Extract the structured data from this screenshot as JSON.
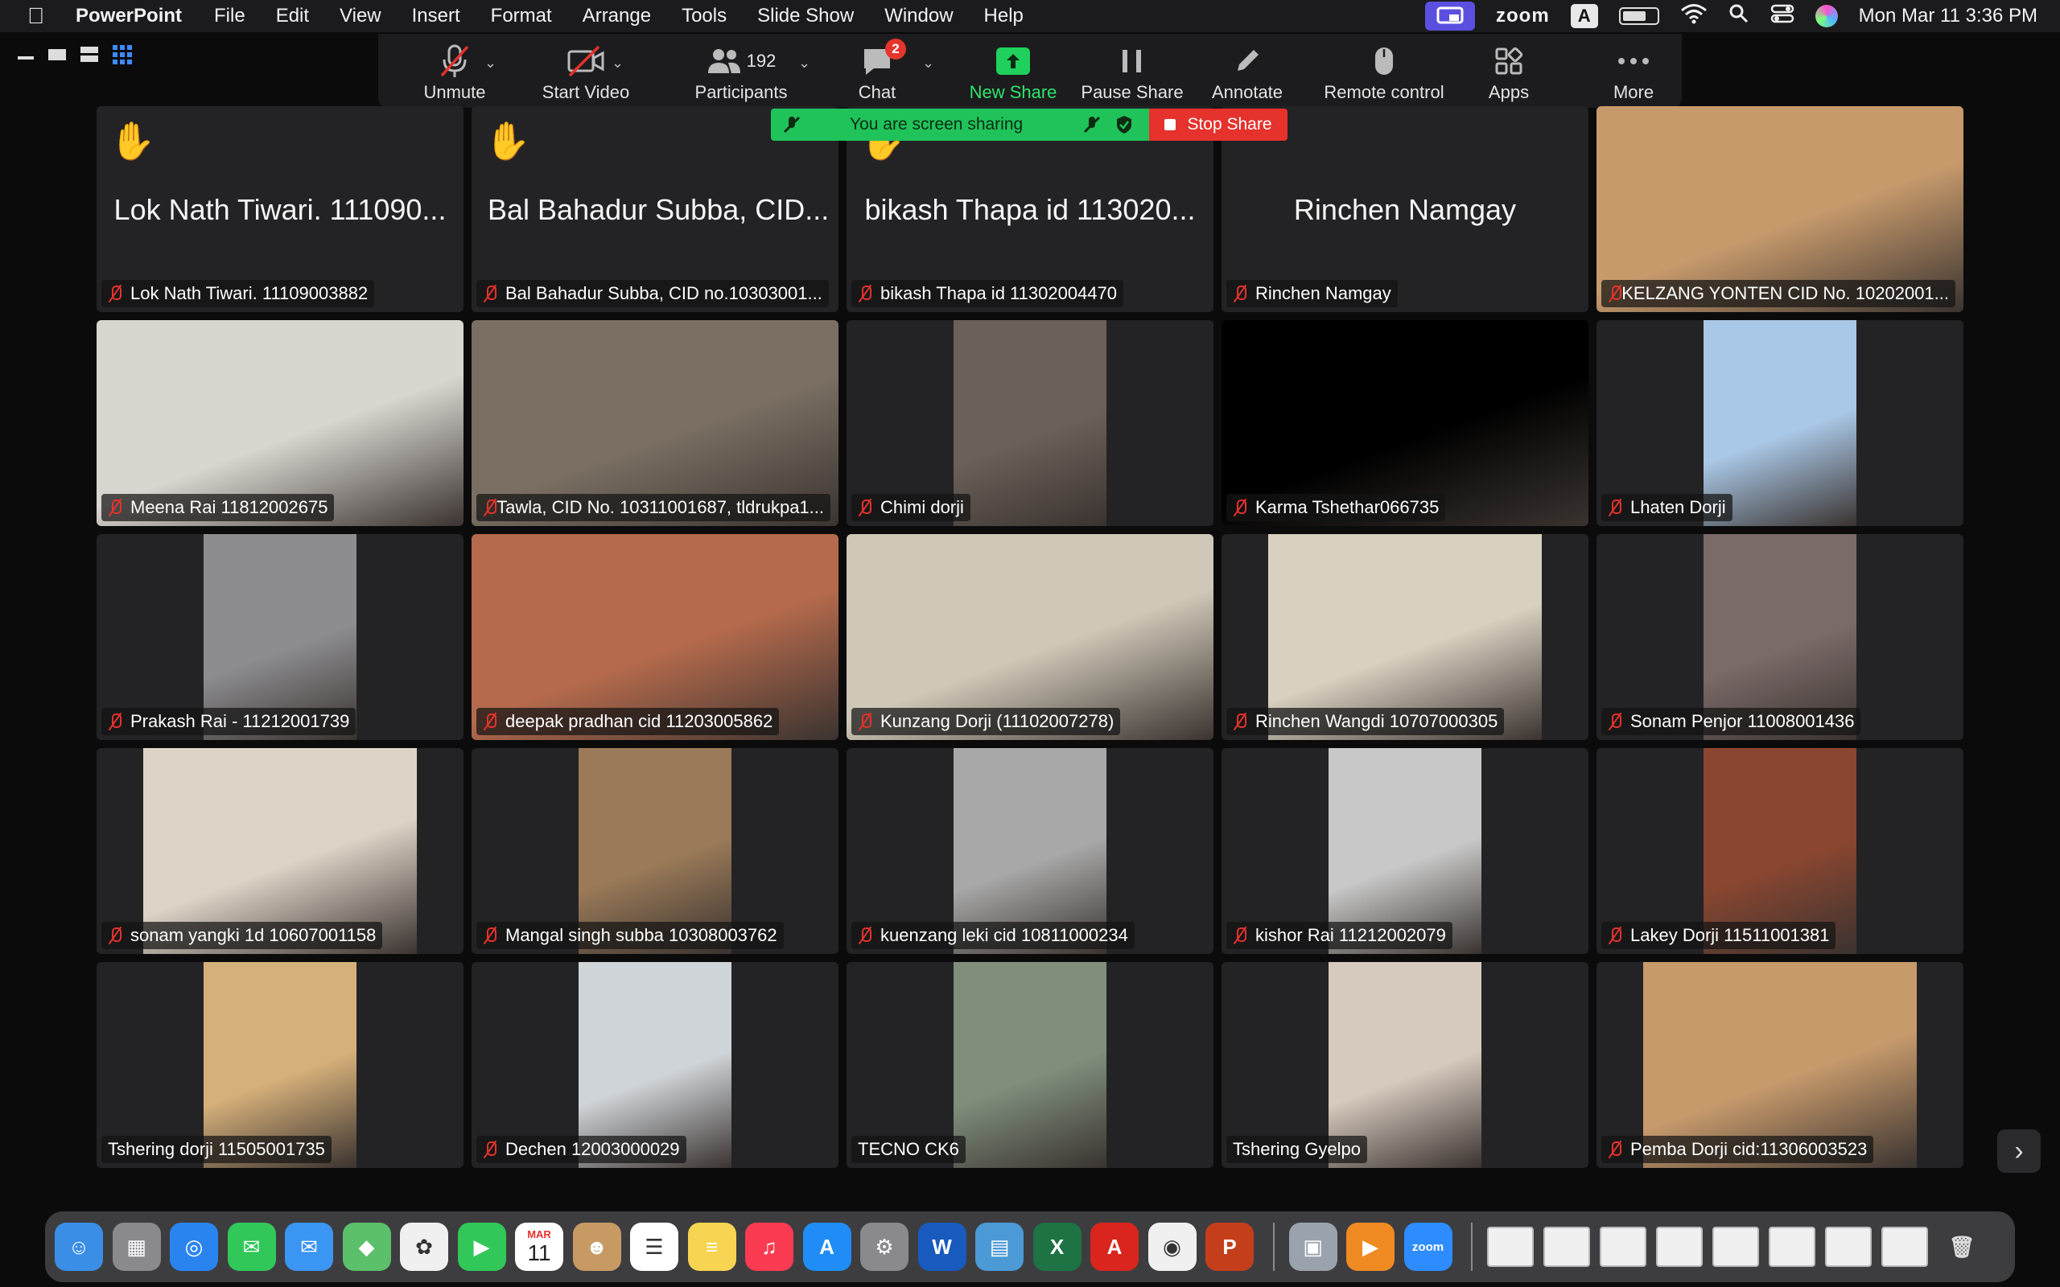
{
  "menubar": {
    "app_name": "PowerPoint",
    "menus": [
      "File",
      "Edit",
      "View",
      "Insert",
      "Format",
      "Arrange",
      "Tools",
      "Slide Show",
      "Window",
      "Help"
    ],
    "zoom_label": "zoom",
    "input_badge": "A",
    "clock": "Mon Mar 11  3:36 PM"
  },
  "toolbar": {
    "unmute": "Unmute",
    "start_video": "Start Video",
    "participants": "Participants",
    "participant_count": "192",
    "chat": "Chat",
    "chat_badge": "2",
    "new_share": "New Share",
    "pause_share": "Pause Share",
    "annotate": "Annotate",
    "remote_control": "Remote control",
    "apps": "Apps",
    "more": "More"
  },
  "share_banner": {
    "message": "You are screen sharing",
    "stop_label": "Stop Share"
  },
  "tiles": [
    {
      "big": "Lok Nath Tiwari. 111090...",
      "name": "Lok Nath Tiwari. 11109003882",
      "hand": true,
      "muted": true,
      "video": false
    },
    {
      "big": "Bal Bahadur Subba, CID...",
      "name": "Bal Bahadur Subba, CID no.10303001...",
      "hand": true,
      "muted": true,
      "video": false
    },
    {
      "big": "bikash Thapa id 113020...",
      "name": "bikash Thapa id 11302004470",
      "hand": true,
      "muted": true,
      "video": false
    },
    {
      "big": "Rinchen Namgay",
      "name": "Rinchen Namgay",
      "hand": false,
      "muted": true,
      "video": false
    },
    {
      "big": "",
      "name": "KELZANG YONTEN CID No. 10202001...",
      "hand": false,
      "muted": true,
      "video": true
    },
    {
      "big": "",
      "name": "Meena Rai 11812002675",
      "hand": false,
      "muted": true,
      "video": true
    },
    {
      "big": "",
      "name": "Tawla, CID No. 10311001687, tldrukpa1...",
      "hand": false,
      "muted": true,
      "video": true
    },
    {
      "big": "",
      "name": "Chimi dorji",
      "hand": false,
      "muted": true,
      "video": true
    },
    {
      "big": "",
      "name": "Karma Tshethar066735",
      "hand": false,
      "muted": true,
      "video": true
    },
    {
      "big": "",
      "name": "Lhaten Dorji",
      "hand": false,
      "muted": true,
      "video": true
    },
    {
      "big": "",
      "name": "Prakash Rai - 11212001739",
      "hand": false,
      "muted": true,
      "video": true
    },
    {
      "big": "",
      "name": "deepak pradhan cid 11203005862",
      "hand": false,
      "muted": true,
      "video": true
    },
    {
      "big": "",
      "name": "Kunzang Dorji (11102007278)",
      "hand": false,
      "muted": true,
      "video": true
    },
    {
      "big": "",
      "name": "Rinchen Wangdi 10707000305",
      "hand": false,
      "muted": true,
      "video": true
    },
    {
      "big": "",
      "name": "Sonam Penjor 11008001436",
      "hand": false,
      "muted": true,
      "video": true
    },
    {
      "big": "",
      "name": "sonam yangki 1d 10607001158",
      "hand": false,
      "muted": true,
      "video": true
    },
    {
      "big": "",
      "name": "Mangal singh subba 10308003762",
      "hand": false,
      "muted": true,
      "video": true
    },
    {
      "big": "",
      "name": "kuenzang leki cid 10811000234",
      "hand": false,
      "muted": true,
      "video": true
    },
    {
      "big": "",
      "name": "kishor Rai 11212002079",
      "hand": false,
      "muted": true,
      "video": true
    },
    {
      "big": "",
      "name": "Lakey Dorji 11511001381",
      "hand": false,
      "muted": true,
      "video": true
    },
    {
      "big": "",
      "name": "Tshering dorji 11505001735",
      "hand": false,
      "muted": false,
      "video": true
    },
    {
      "big": "",
      "name": "Dechen 12003000029",
      "hand": false,
      "muted": true,
      "video": true
    },
    {
      "big": "",
      "name": "TECNO CK6",
      "hand": false,
      "muted": false,
      "video": true
    },
    {
      "big": "",
      "name": "Tshering Gyelpo",
      "hand": false,
      "muted": false,
      "video": true
    },
    {
      "big": "",
      "name": "Pemba Dorji cid:11306003523",
      "hand": false,
      "muted": true,
      "video": true
    }
  ],
  "tile_colors": [
    "#c79a6c",
    "#d9d6d0",
    "#7a6f62",
    "#6b6159",
    "#000000",
    "#a9c7e6",
    "#8d8d90",
    "#b56a4c",
    "#cfc8b8",
    "#d8d0c0",
    "#7a6a68",
    "#ddd3c6",
    "#9a7a58",
    "#a8a8a8",
    "#c8c8c8",
    "#8a4630",
    "#d6b07a",
    "#cfd4d8",
    "#7f8f7c",
    "#d6c9bd"
  ],
  "dock_apps": [
    {
      "name": "finder",
      "color": "#3a8ee6",
      "glyph": "☺"
    },
    {
      "name": "launchpad",
      "color": "#8a8a8e",
      "glyph": "▦"
    },
    {
      "name": "safari",
      "color": "#2a84f0",
      "glyph": "◎"
    },
    {
      "name": "messages",
      "color": "#32c759",
      "glyph": "✉"
    },
    {
      "name": "mail",
      "color": "#3b96f3",
      "glyph": "✉"
    },
    {
      "name": "maps",
      "color": "#5cbf6a",
      "glyph": "◆"
    },
    {
      "name": "photos",
      "color": "#f0f0f0",
      "glyph": "✿"
    },
    {
      "name": "facetime",
      "color": "#32c759",
      "glyph": "▶"
    },
    {
      "name": "calendar",
      "color": "#ffffff",
      "glyph": "11"
    },
    {
      "name": "contacts",
      "color": "#c79a64",
      "glyph": "☻"
    },
    {
      "name": "reminders",
      "color": "#ffffff",
      "glyph": "☰"
    },
    {
      "name": "notes",
      "color": "#f7d451",
      "glyph": "≡"
    },
    {
      "name": "music",
      "color": "#fa3b51",
      "glyph": "♫"
    },
    {
      "name": "app-store",
      "color": "#1f8df5",
      "glyph": "A"
    },
    {
      "name": "system-settings",
      "color": "#8a8a8e",
      "glyph": "⚙"
    },
    {
      "name": "word",
      "color": "#185abd",
      "glyph": "W"
    },
    {
      "name": "preview",
      "color": "#4b9ad6",
      "glyph": "▤"
    },
    {
      "name": "excel",
      "color": "#1d7344",
      "glyph": "X"
    },
    {
      "name": "acrobat",
      "color": "#d9251d",
      "glyph": "A"
    },
    {
      "name": "chrome",
      "color": "#f0f0f0",
      "glyph": "◉"
    },
    {
      "name": "powerpoint",
      "color": "#c43e1c",
      "glyph": "P"
    }
  ],
  "dock_apps_right": [
    {
      "name": "image-capture",
      "color": "#9aa3ad",
      "glyph": "▣"
    },
    {
      "name": "media-player",
      "color": "#f08a22",
      "glyph": "▶"
    },
    {
      "name": "zoom",
      "color": "#2d8cff",
      "glyph": "zoom"
    }
  ],
  "calendar_month": "MAR"
}
